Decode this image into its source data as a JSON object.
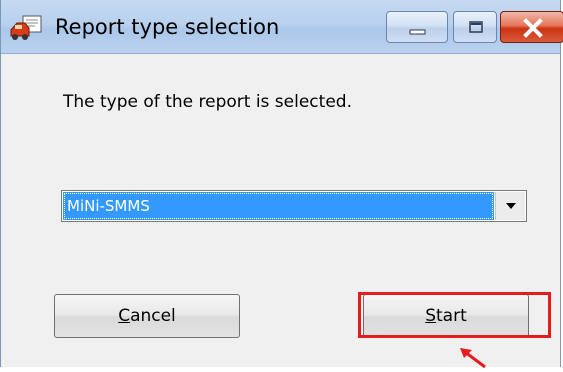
{
  "window": {
    "title": "Report type selection",
    "icon": "report-app-icon"
  },
  "titlebar_buttons": {
    "minimize_icon": "minimize-icon",
    "maximize_icon": "maximize-icon",
    "close_icon": "close-icon"
  },
  "dialog": {
    "prompt": "The type of the report is selected.",
    "report_type_select": {
      "selected_value": "MiNi-SMMS",
      "arrow_icon": "dropdown-arrow-icon"
    },
    "buttons": {
      "cancel": {
        "access_key": "C",
        "rest": "ancel"
      },
      "start": {
        "access_key": "S",
        "rest": "tart"
      }
    }
  },
  "annotation": {
    "highlight_color": "#e61b1b",
    "arrow_color": "#e61b1b"
  },
  "colors": {
    "selection_bg": "#3399ff",
    "titlebar": "#b9d1ee",
    "close_button": "#cc3414"
  }
}
